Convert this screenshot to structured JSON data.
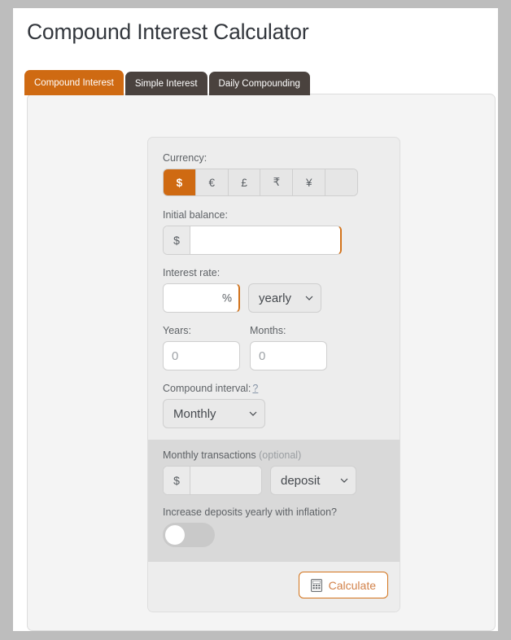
{
  "page": {
    "title": "Compound Interest Calculator"
  },
  "tabs": [
    {
      "label": "Compound Interest",
      "active": true
    },
    {
      "label": "Simple Interest",
      "active": false
    },
    {
      "label": "Daily Compounding",
      "active": false
    }
  ],
  "form": {
    "currency": {
      "label": "Currency:",
      "options": [
        "$",
        "€",
        "£",
        "₹",
        "¥",
        ""
      ],
      "selected": "$"
    },
    "initial_balance": {
      "label": "Initial balance:",
      "prefix": "$",
      "value": "",
      "placeholder": ""
    },
    "interest_rate": {
      "label": "Interest rate:",
      "value": "",
      "placeholder": "",
      "suffix": "%",
      "period": "yearly"
    },
    "years": {
      "label": "Years:",
      "value": "",
      "placeholder": "0"
    },
    "months": {
      "label": "Months:",
      "value": "",
      "placeholder": "0"
    },
    "compound_interval": {
      "label": "Compound interval:",
      "help": "?",
      "selected": "Monthly"
    },
    "monthly_transactions": {
      "label": "Monthly transactions",
      "optional_note": "(optional)",
      "prefix": "$",
      "value": "",
      "placeholder": "",
      "type": "deposit"
    },
    "inflation": {
      "label": "Increase deposits yearly with inflation?",
      "enabled": false
    },
    "calculate": {
      "label": "Calculate",
      "icon": "calculator-icon"
    }
  },
  "colors": {
    "accent": "#cf6a12",
    "tab_inactive": "#4a423e",
    "page_bg": "#bdbdbd",
    "panel_bg": "#f4f4f4",
    "form_bg": "#ededed",
    "transactions_bg": "#d9d9d9"
  }
}
